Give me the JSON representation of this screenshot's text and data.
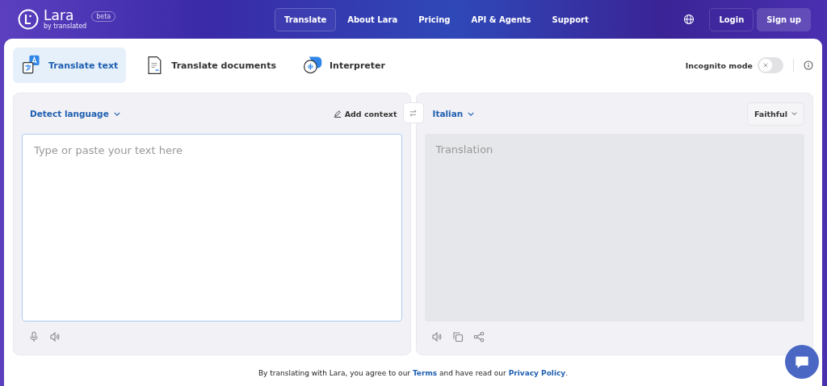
{
  "brand": {
    "name": "Lara",
    "tagline": "by translated",
    "badge": "beta"
  },
  "nav": [
    {
      "label": "Translate",
      "selected": true
    },
    {
      "label": "About Lara",
      "selected": false
    },
    {
      "label": "Pricing",
      "selected": false
    },
    {
      "label": "API & Agents",
      "selected": false
    },
    {
      "label": "Support",
      "selected": false
    }
  ],
  "auth": {
    "login": "Login",
    "signup": "Sign up"
  },
  "modes": [
    {
      "label": "Translate text",
      "kind": "text",
      "selected": true
    },
    {
      "label": "Translate documents",
      "kind": "documents",
      "selected": false
    },
    {
      "label": "Interpreter",
      "kind": "interpreter",
      "selected": false
    }
  ],
  "incognito": {
    "label": "Incognito mode",
    "on": false
  },
  "source": {
    "language": "Detect language",
    "add_context": "Add context",
    "placeholder": "Type or paste your text here"
  },
  "target": {
    "language": "Italian",
    "style": "Faithful",
    "placeholder": "Translation"
  },
  "footer": [
    {
      "kind": "text",
      "text": "By translating with Lara, you agree to our "
    },
    {
      "kind": "link",
      "text": "Terms"
    },
    {
      "kind": "text",
      "text": " and have read our "
    },
    {
      "kind": "link",
      "text": "Privacy Policy"
    },
    {
      "kind": "text",
      "text": "."
    }
  ]
}
